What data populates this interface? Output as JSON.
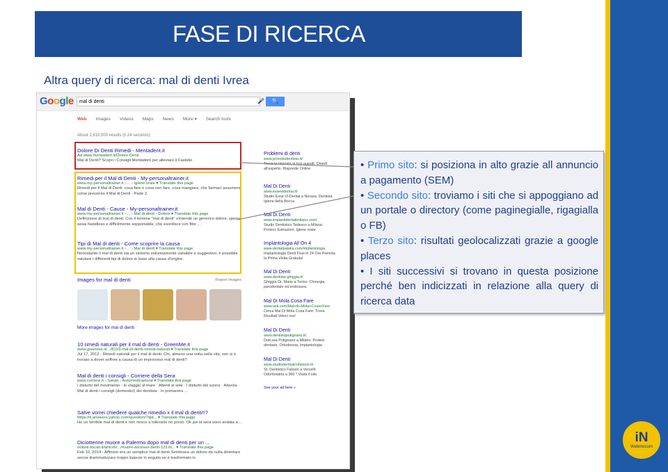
{
  "slide": {
    "title": "FASE DI RICERCA",
    "subtitle": "Altra query di ricerca: mal di denti Ivrea"
  },
  "logo": {
    "text": "iN",
    "sub": "Webmecum"
  },
  "google": {
    "logo": [
      "G",
      "o",
      "o",
      "g",
      "l",
      "e"
    ],
    "query": "mal di denti",
    "search_button": "🔍",
    "tabs": [
      "Web",
      "Images",
      "Videos",
      "Maps",
      "News",
      "More ▾",
      "Search tools"
    ],
    "results_count": "About 2,610,000 results (0.24 seconds)",
    "ad": {
      "title": "Dolore Di Denti Rimedi - Mentadent.it",
      "url": "Ad  www.mentadent.it/Dolore-Denti",
      "snippet": "Mal di Denti? Scopri i Consigli Mentadent per alleviare il Fastidio"
    },
    "results": [
      {
        "title": "Rimedi per il Mal di Denti - My-personaltrainer.it",
        "url": "www.my-personaltrainer.it › ... › Igiene orale  ▾  Translate this page",
        "snippet": "Rimedi per il Mal di Denti: cosa fare e cosa non fare, cosa mangiare, che farmaci assumere, come prevenire il Mal di Denti - Parte 2."
      },
      {
        "title": "Mal di Denti - Cause - My-personaltrainer.it",
        "url": "www.my-personaltrainer.it › ... › Mal di denti › Dolore  ▾  Translate this page",
        "snippet": "Definizione di mal di denti. Con il termine \"mal di denti\" s'intende un generico dolore, spesso assai fastidioso e difficilmente sopportabile, che esordisce con fitte ..."
      },
      {
        "title": "Tipi di Mal di denti - Come scoprire la causa",
        "url": "www.my-personaltrainer.it › ... › Mal di denti  ▾  Translate this page",
        "snippet": "Nonostante il mal di denti sia un sintomo estremamente variabile e suggestivo, è possibile valutare i differenti tipi di dolore in base alla causa d'origine."
      }
    ],
    "images_header": "Images for mal di denti",
    "report_images": "Report images",
    "more_images": "More images for mal di denti",
    "results2": [
      {
        "title": "10 rimedi naturali per il mal di denti - GreenMe.it",
        "url": "www.greenme.it/.../8153-mal-di-denti-rimedi-naturali  ▾  Translate this page",
        "snippet": "Jul 17, 2012 - Rimedi naturali per il mal di denti. Chi, almeno una volta nella vita, non si è trovato a dover soffrire a causa di un improvviso mal di denti?"
      },
      {
        "title": "Mal di denti i consigli - Corriere della Sera",
        "url": "www.corriere.it › Salute › Automedicazione  ▾  Translate this page",
        "snippet": "I disturbi del movimento · In viaggio al mare · Attenti al sole · I disturbi del sonno · Afavola · Mal di denti i consigli (domestici) del dentista · In primavera ..."
      },
      {
        "title": "Salve vorrei chiedere qualche rimedio x il mal di denti!!?",
        "url": "https://it.answers.yahoo.com/question/?qid...  ▾  Translate this page",
        "snippet": "Ho un terribile mal di denti e non riesco a tollerarlo no preso. Ok poi la sera sono andata a ..."
      },
      {
        "title": "Diciottenne muore a Palermo dopo mal di denti per un ...",
        "url": "notizie.tiscali.it/articoli/.../muore-ascesso-denti-123.ht...  ▾  Translate this page",
        "snippet": "Feb 10, 2014 - Affinizio era un semplice mal di denti Sembrava un dolore da nulla diventare senza drammatizzare troppo Eppure in seguito se è trasformato in"
      }
    ],
    "local": [
      {
        "title": "Problemi di denti",
        "url": "www.pronotodentista.it/",
        "snippet": "Trova la risposta ai tuoi quesiti. Chiedi all'esperto. Risponde Online"
      },
      {
        "title": "Mal Di Denti",
        "url": "www.essevidental.it/",
        "snippet": "Studio Esse.Vi-Dental a Novara: Dentista Igiene della Bocca"
      },
      {
        "title": "Mal Di Denti",
        "url": "www.impiantidentalimilano.com/",
        "snippet": "Studio Dentistico Tedesco a Milano: Protesi, Estrazioni, Igiene orale."
      },
      {
        "title": "Implantologia All On 4",
        "url": "www.dentalpatalia.com/implantologia",
        "snippet": "Implantologia Denti Fissi in 24 Ore Prenota la Prima Visita Gratuita!"
      },
      {
        "title": "Mal Di Denti",
        "url": "www.dentista-ghiggia.it/",
        "snippet": "Ghiggia Dr. Mario a Torino: Chirurgia parodontale ed endossea."
      },
      {
        "title": "Mal Di Mola Cosa Fare",
        "url": "www.ask.com/Mal+di+Mola+Cosa+Fare",
        "snippet": "Cerca Mal Di Mola Cosa Fare. Trova Risultati Veloci ora!"
      },
      {
        "title": "Mal Di Denti",
        "url": "www.dentistaputignano.it/",
        "snippet": "Dott.ssa Putignano a Milano: Protesi dentarie, Ortodonzia, Implantologia"
      },
      {
        "title": "Mal Di Denti",
        "url": "www.studiodentisticofalsoni.it/",
        "snippet": "St. Dentistico Falsoni a Vercelli: Odontoiatria a 360 * Visita il sito"
      }
    ],
    "see_ad": "See your ad here »"
  },
  "callout": {
    "items": [
      {
        "highlight": "Primo sito",
        "text": ": si posiziona in alto grazie all annuncio a pagamento (SEM)"
      },
      {
        "highlight": "Secondo sito",
        "text": ": troviamo i siti che si appoggiano ad un portale o directory (come paginegialle, rigagialla o FB)"
      },
      {
        "highlight": "Terzo sito",
        "text": ": risultati geolocalizzati grazie a google places"
      },
      {
        "highlight": "",
        "text": "I siti successivi si trovano in questa posizione perché ben indicizzati in relazione alla query di ricerca data"
      }
    ]
  },
  "colors": {
    "title_bar": "#1f4e99",
    "accent_yellow": "#f2c200",
    "accent_blue": "#1f5aa8",
    "ad_box": "#c0282a",
    "callout_text": "#1f3d8a",
    "callout_highlight": "#3d7fd6"
  }
}
